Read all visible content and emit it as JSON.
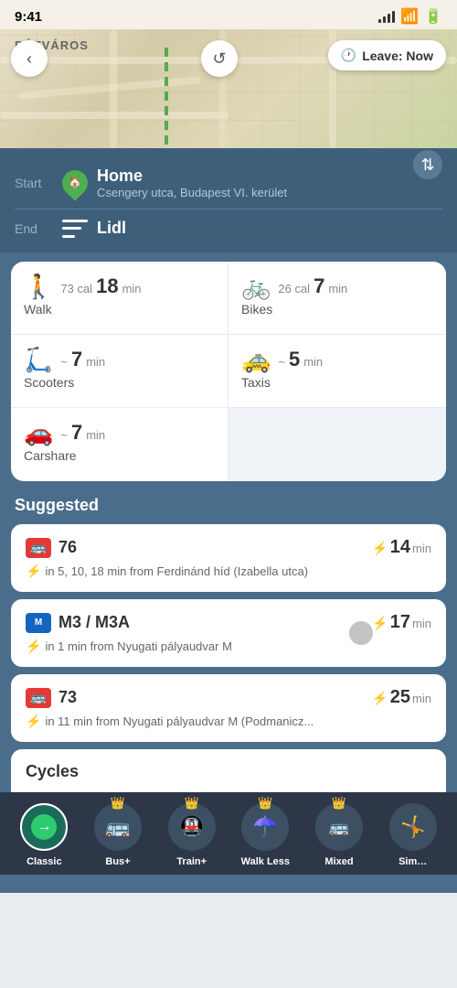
{
  "statusBar": {
    "time": "9:41",
    "city": "PÓTVÁROS"
  },
  "mapButtons": {
    "back": "‹",
    "refresh": "↺",
    "leave": "Leave: Now"
  },
  "route": {
    "startLabel": "Start",
    "startName": "Home",
    "startAddress": "Csengery utca, Budapest VI. kerület",
    "endLabel": "End",
    "endName": "Lidl"
  },
  "transport": [
    {
      "icon": "🚶",
      "cal": "73 cal",
      "time": "18",
      "timePrefix": "",
      "name": "Walk"
    },
    {
      "icon": "🚲",
      "cal": "26 cal",
      "time": "7",
      "timePrefix": "",
      "name": "Bikes"
    },
    {
      "icon": "🛴",
      "cal": "",
      "time": "7",
      "timePrefix": "~",
      "name": "Scooters"
    },
    {
      "icon": "🚕",
      "cal": "",
      "time": "5",
      "timePrefix": "~",
      "name": "Taxis"
    },
    {
      "icon": "🚗",
      "cal": "",
      "time": "7",
      "timePrefix": "~",
      "name": "Carshare"
    },
    {
      "icon": "",
      "cal": "",
      "time": "",
      "timePrefix": "",
      "name": ""
    }
  ],
  "suggested": {
    "title": "Suggested",
    "routes": [
      {
        "type": "bus",
        "number": "76",
        "time": "14",
        "detail": "in 5, 10, 18 min from Ferdinánd híd (Izabella utca)"
      },
      {
        "type": "metro",
        "number": "M3 / M3A",
        "time": "17",
        "detail": "in 1 min from Nyugati pályaudvar M"
      },
      {
        "type": "bus",
        "number": "73",
        "time": "25",
        "detail": "in 11 min from Nyugati pályaudvar M (Podmanicz..."
      }
    ]
  },
  "cycles": {
    "title": "Cycles"
  },
  "bottomNav": {
    "items": [
      {
        "label": "Classic",
        "active": true,
        "icon": "→",
        "hasCrown": false
      },
      {
        "label": "Bus+",
        "active": false,
        "icon": "🚌",
        "hasCrown": true
      },
      {
        "label": "Train+",
        "active": false,
        "icon": "🚇",
        "hasCrown": true
      },
      {
        "label": "Walk Less",
        "active": false,
        "icon": "☂",
        "hasCrown": true
      },
      {
        "label": "Mixed",
        "active": false,
        "icon": "🚌🚗",
        "hasCrown": true
      },
      {
        "label": "Sim…",
        "active": false,
        "icon": "🤸",
        "hasCrown": false
      }
    ]
  }
}
